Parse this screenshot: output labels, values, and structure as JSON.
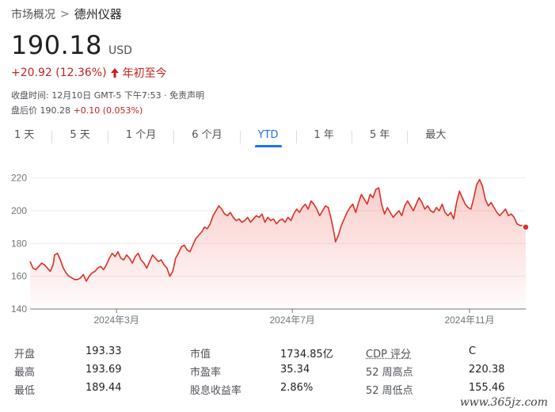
{
  "breadcrumb": {
    "parent": "市场概况",
    "separator": ">",
    "current": "德州仪器"
  },
  "quote": {
    "price": "190.18",
    "currency": "USD",
    "change": "+20.92 (12.36%)",
    "change_period": "年初至今",
    "direction_icon": "arrow-up-icon",
    "close_time": "收盘时间: 12月10日 GMT-5 下午7:53 · 免责声明",
    "after_hours_label": "盘后价",
    "after_hours_price": "190.28",
    "after_hours_change": "+0.10 (0.053%)"
  },
  "tabs": [
    "1 天",
    "5 天",
    "1 个月",
    "6 个月",
    "YTD",
    "1 年",
    "5 年",
    "最大"
  ],
  "active_tab": "YTD",
  "colors": {
    "accent_blue": "#1a73e8",
    "line_red": "#d93025",
    "change_red": "#c5221f"
  },
  "chart_data": {
    "type": "area",
    "ylim": [
      140,
      230
    ],
    "y_ticks": [
      140,
      160,
      180,
      200,
      220
    ],
    "x_tick_labels": [
      "2024年3月",
      "2024年7月",
      "2024年11月"
    ],
    "x_tick_days": [
      60,
      182,
      305
    ],
    "x_range_days": [
      0,
      344
    ],
    "grid": true,
    "series": [
      {
        "points": [
          [
            0,
            169
          ],
          [
            2,
            165
          ],
          [
            4,
            164
          ],
          [
            6,
            166
          ],
          [
            8,
            168
          ],
          [
            10,
            167
          ],
          [
            12,
            165
          ],
          [
            14,
            163
          ],
          [
            16,
            167
          ],
          [
            17,
            173
          ],
          [
            19,
            174
          ],
          [
            21,
            170
          ],
          [
            23,
            165
          ],
          [
            25,
            162
          ],
          [
            27,
            160
          ],
          [
            29,
            159
          ],
          [
            31,
            158
          ],
          [
            33,
            158
          ],
          [
            35,
            159
          ],
          [
            37,
            161
          ],
          [
            39,
            157
          ],
          [
            41,
            160
          ],
          [
            43,
            162
          ],
          [
            45,
            163
          ],
          [
            47,
            165
          ],
          [
            49,
            166
          ],
          [
            51,
            164
          ],
          [
            53,
            167
          ],
          [
            55,
            171
          ],
          [
            57,
            174
          ],
          [
            59,
            172
          ],
          [
            61,
            175
          ],
          [
            63,
            171
          ],
          [
            65,
            170
          ],
          [
            67,
            173
          ],
          [
            69,
            171
          ],
          [
            71,
            168
          ],
          [
            73,
            172
          ],
          [
            75,
            174
          ],
          [
            77,
            170
          ],
          [
            79,
            168
          ],
          [
            81,
            165
          ],
          [
            83,
            169
          ],
          [
            85,
            173
          ],
          [
            87,
            171
          ],
          [
            89,
            169
          ],
          [
            91,
            170
          ],
          [
            93,
            167
          ],
          [
            95,
            165
          ],
          [
            97,
            160
          ],
          [
            99,
            163
          ],
          [
            101,
            171
          ],
          [
            103,
            174
          ],
          [
            105,
            178
          ],
          [
            107,
            179
          ],
          [
            109,
            176
          ],
          [
            111,
            175
          ],
          [
            113,
            179
          ],
          [
            115,
            183
          ],
          [
            117,
            185
          ],
          [
            119,
            187
          ],
          [
            121,
            190
          ],
          [
            123,
            189
          ],
          [
            125,
            192
          ],
          [
            127,
            197
          ],
          [
            129,
            200
          ],
          [
            131,
            203
          ],
          [
            133,
            201
          ],
          [
            135,
            198
          ],
          [
            137,
            197
          ],
          [
            139,
            199
          ],
          [
            141,
            196
          ],
          [
            143,
            194
          ],
          [
            145,
            195
          ],
          [
            147,
            193
          ],
          [
            149,
            194
          ],
          [
            151,
            196
          ],
          [
            153,
            193
          ],
          [
            155,
            195
          ],
          [
            157,
            197
          ],
          [
            159,
            196
          ],
          [
            161,
            198
          ],
          [
            163,
            193
          ],
          [
            165,
            196
          ],
          [
            167,
            194
          ],
          [
            169,
            195
          ],
          [
            171,
            192
          ],
          [
            173,
            194
          ],
          [
            175,
            195
          ],
          [
            177,
            193
          ],
          [
            179,
            196
          ],
          [
            181,
            194
          ],
          [
            183,
            198
          ],
          [
            185,
            201
          ],
          [
            187,
            199
          ],
          [
            189,
            202
          ],
          [
            191,
            204
          ],
          [
            193,
            201
          ],
          [
            195,
            206
          ],
          [
            197,
            204
          ],
          [
            199,
            201
          ],
          [
            201,
            197
          ],
          [
            203,
            200
          ],
          [
            205,
            203
          ],
          [
            207,
            202
          ],
          [
            209,
            195
          ],
          [
            211,
            186
          ],
          [
            212,
            181
          ],
          [
            214,
            185
          ],
          [
            216,
            191
          ],
          [
            218,
            195
          ],
          [
            220,
            199
          ],
          [
            222,
            202
          ],
          [
            224,
            204
          ],
          [
            226,
            199
          ],
          [
            228,
            205
          ],
          [
            230,
            210
          ],
          [
            232,
            207
          ],
          [
            234,
            204
          ],
          [
            236,
            210
          ],
          [
            238,
            208
          ],
          [
            240,
            213
          ],
          [
            242,
            214
          ],
          [
            244,
            204
          ],
          [
            246,
            198
          ],
          [
            248,
            202
          ],
          [
            250,
            199
          ],
          [
            252,
            196
          ],
          [
            254,
            198
          ],
          [
            256,
            200
          ],
          [
            258,
            197
          ],
          [
            260,
            203
          ],
          [
            262,
            206
          ],
          [
            264,
            203
          ],
          [
            266,
            200
          ],
          [
            268,
            204
          ],
          [
            270,
            208
          ],
          [
            272,
            205
          ],
          [
            274,
            201
          ],
          [
            276,
            203
          ],
          [
            278,
            200
          ],
          [
            280,
            199
          ],
          [
            282,
            202
          ],
          [
            284,
            200
          ],
          [
            286,
            204
          ],
          [
            288,
            199
          ],
          [
            290,
            197
          ],
          [
            292,
            199
          ],
          [
            294,
            195
          ],
          [
            296,
            205
          ],
          [
            298,
            212
          ],
          [
            300,
            208
          ],
          [
            302,
            204
          ],
          [
            304,
            202
          ],
          [
            306,
            201
          ],
          [
            308,
            208
          ],
          [
            310,
            216
          ],
          [
            312,
            219
          ],
          [
            314,
            215
          ],
          [
            316,
            207
          ],
          [
            318,
            203
          ],
          [
            320,
            205
          ],
          [
            322,
            202
          ],
          [
            324,
            199
          ],
          [
            326,
            197
          ],
          [
            328,
            199
          ],
          [
            330,
            201
          ],
          [
            332,
            197
          ],
          [
            334,
            198
          ],
          [
            336,
            196
          ],
          [
            338,
            192
          ],
          [
            340,
            191
          ],
          [
            342,
            191
          ],
          [
            344,
            190
          ]
        ]
      }
    ]
  },
  "stats": [
    {
      "label": "开盘",
      "value": "193.33",
      "label2": "市值",
      "value2": "1734.85亿",
      "label3": "CDP 评分",
      "value3": "C"
    },
    {
      "label": "最高",
      "value": "193.69",
      "label2": "市盈率",
      "value2": "35.34",
      "label3": "52 周高点",
      "value3": "220.38"
    },
    {
      "label": "最低",
      "value": "189.44",
      "label2": "股息收益率",
      "value2": "2.86%",
      "label3": "52 周低点",
      "value3": "155.46"
    }
  ],
  "watermark": "www.365jz.com"
}
